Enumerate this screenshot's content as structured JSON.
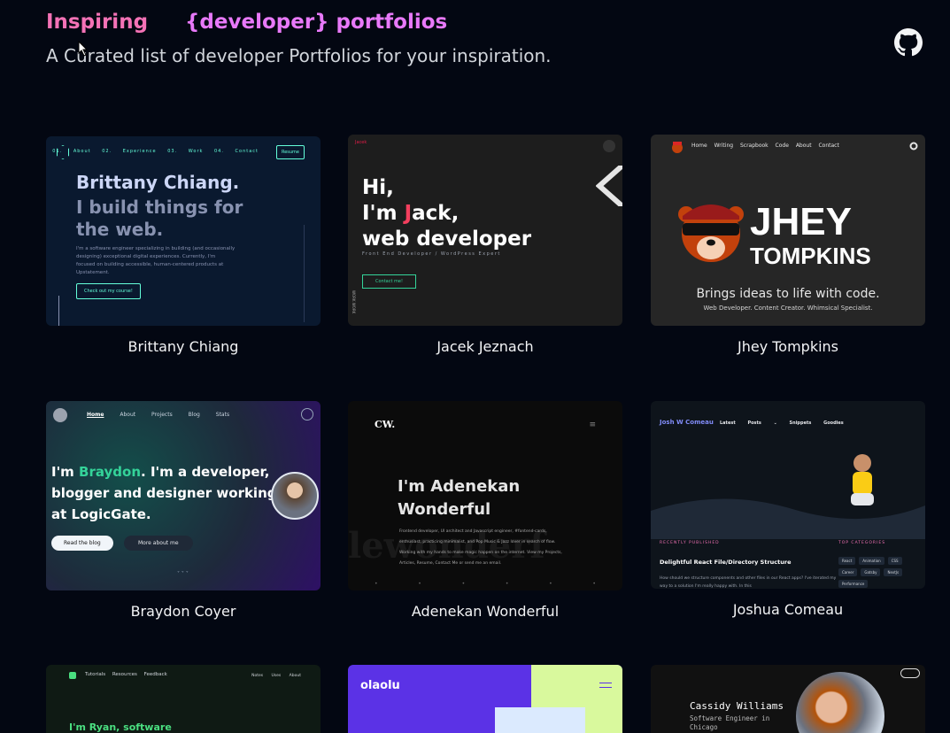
{
  "header": {
    "title_part1": "Inspiring",
    "title_part2": "{developer} portfolios",
    "subtitle": "A Curated list of developer Portfolios for your inspiration.",
    "github_icon": "github-icon"
  },
  "portfolios": [
    {
      "name": "Brittany Chiang",
      "shot": {
        "nav": "01. About  02. Experience  03. Work  04. Contact",
        "resume": "Resume",
        "line1": "Brittany Chiang.",
        "line2": "I build things for the web.",
        "para": "I'm a software engineer specializing in building (and occasionally designing) exceptional digital experiences. Currently, I'm focused on building accessible, human-centered products at Upstatement.",
        "button": "Check out my course!"
      }
    },
    {
      "name": "Jacek Jeznach",
      "shot": {
        "brand": "Jacek",
        "line1": "Hi,",
        "line2a": "I'm ",
        "line2j": "J",
        "line2b": "ack,",
        "line3": "web developer",
        "sub": "Front End Developer / WordPress Expert",
        "button": "Contact me!",
        "side": "WORK WORK"
      }
    },
    {
      "name": "Jhey Tompkins",
      "shot": {
        "nav": "Home  Writing  Scrapbook  Code  About  Contact",
        "title1": "JHEY",
        "title2": "TOMPKINS",
        "tagline": "Brings ideas to life with code.",
        "roles": "Web Developer. Content Creator. Whimsical Specialist."
      }
    },
    {
      "name": "Braydon Coyer",
      "shot": {
        "nav_active": "Home",
        "nav_rest": "About  Projects  Blog  Stats",
        "pre": "I'm ",
        "hl": "Braydon",
        "post": ". I'm a developer, blogger and designer working at LogicGate.",
        "btn1": "Read the blog",
        "btn2": "More about me",
        "dots": "˅ ˅ ˅"
      }
    },
    {
      "name": "Adenekan Wonderful",
      "shot": {
        "logo": "CW.",
        "menu": "≡",
        "line1": "I'm Adenekan",
        "line2": "Wonderful",
        "para": "Frontend developer, UI architect and Javascript engineer, #fontend-cards, enthusiast, practicing minimalist, and Pop Music & Jazz lover in search of flow. Working with my hands to make magic happen on the internet. View my Projects, Articles, Resume, Contact Me or send me an email.",
        "bg": "lewonderf",
        "footer": [
          "•",
          "•",
          "•",
          "•",
          "•",
          "•"
        ]
      }
    },
    {
      "name": "Joshua Comeau",
      "shot": {
        "logo": "Josh W Comeau",
        "nav": "Latest  Posts ⌄  Snippets  Goodies",
        "recent": "RECENTLY PUBLISHED",
        "topcat": "TOP CATEGORIES",
        "article": "Delightful React File/Directory Structure",
        "article_p": "How should we structure components and other files in our React apps? I've iterated my way to a solution I'm really happy with. In this",
        "tags": [
          "React",
          "Animation",
          "CSS",
          "Career",
          "Gatsby",
          "NextJs",
          "Performance"
        ]
      }
    },
    {
      "name": "",
      "shot": {
        "nav": "Tutorials  Resources  Feedback",
        "rnav": "Notes  Uses  About",
        "headline": "I'm Ryan, software"
      }
    },
    {
      "name": "",
      "shot": {
        "logo": "olaolu"
      }
    },
    {
      "name": "",
      "shot": {
        "name": "Cassidy Williams",
        "role": "Software Engineer in Chicago"
      }
    }
  ],
  "colors": {
    "background": "#030712",
    "title_pink": "#f472b6",
    "title_magenta": "#e879f9"
  }
}
